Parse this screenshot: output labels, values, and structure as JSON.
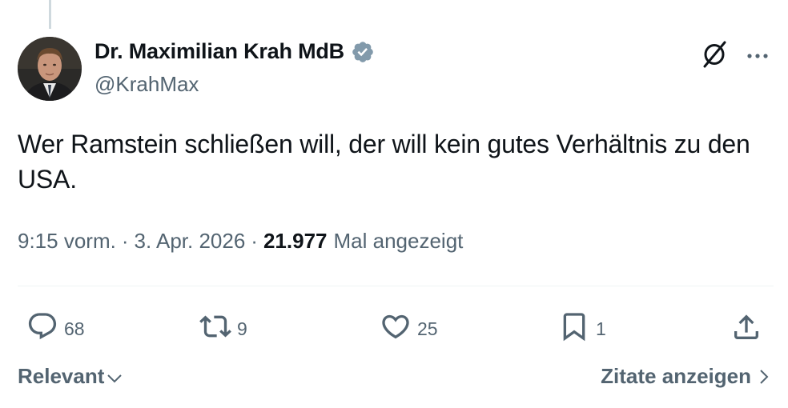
{
  "author": {
    "display_name": "Dr. Maximilian Krah MdB",
    "handle": "@KrahMax",
    "verified": true,
    "verified_color": "#829aab"
  },
  "tweet": {
    "text": "Wer Ramstein schließen will, der will kein gutes Verhältnis zu den USA."
  },
  "meta": {
    "time": "9:15 vorm.",
    "separator": "·",
    "date": "3. Apr. 2026",
    "views_count": "21.977",
    "views_label": "Mal angezeigt"
  },
  "actions": {
    "replies": "68",
    "reposts": "9",
    "likes": "25",
    "bookmarks": "1"
  },
  "footer": {
    "sort_label": "Relevant",
    "quotes_label": "Zitate anzeigen"
  },
  "icons": {
    "header": [
      "grok-icon",
      "more-icon"
    ],
    "actions": [
      "reply-icon",
      "repost-icon",
      "like-icon",
      "bookmark-icon",
      "share-icon"
    ]
  },
  "colors": {
    "text_primary": "#0f1419",
    "text_secondary": "#536471",
    "divider": "#eff3f4"
  }
}
